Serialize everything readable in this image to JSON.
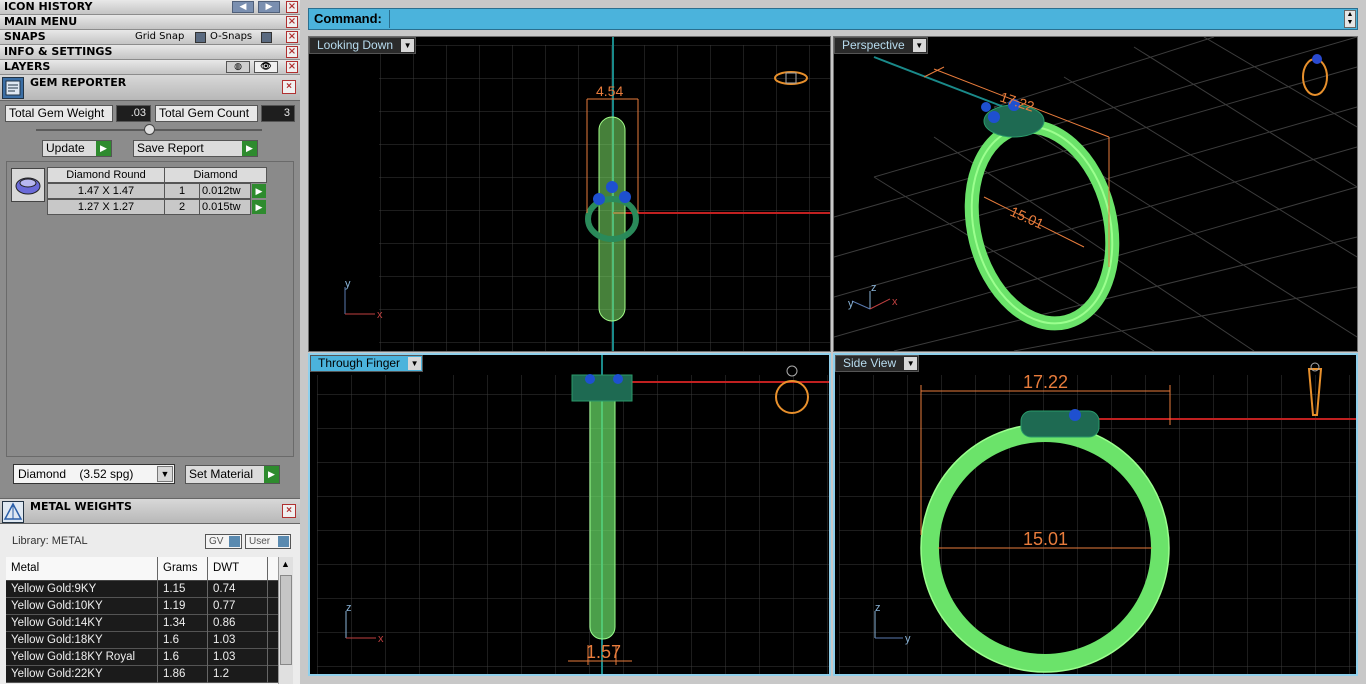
{
  "menu": {
    "icon_history": "ICON HISTORY",
    "main_menu": "MAIN MENU",
    "snaps": "SNAPS",
    "grid_snap": "Grid Snap",
    "o_snaps": "O-Snaps",
    "info_settings": "INFO & SETTINGS",
    "layers": "LAYERS"
  },
  "gem_reporter": {
    "title": "GEM REPORTER",
    "total_weight_label": "Total Gem Weight",
    "total_weight_value": ".03",
    "total_count_label": "Total Gem Count",
    "total_count_value": "3",
    "update_label": "Update",
    "save_report_label": "Save Report",
    "table": {
      "shape": "Diamond Round",
      "type": "Diamond",
      "rows": [
        {
          "size": "1.47 X 1.47",
          "count": "1",
          "weight": "0.012tw"
        },
        {
          "size": "1.27 X 1.27",
          "count": "2",
          "weight": "0.015tw"
        }
      ]
    },
    "material": "Diamond    (3.52 spg)",
    "set_material_label": "Set Material"
  },
  "metal_weights": {
    "title": "METAL WEIGHTS",
    "library": "Library: METAL",
    "gv_label": "GV",
    "user_label": "User",
    "headers": [
      "Metal",
      "Grams",
      "DWT"
    ],
    "rows": [
      [
        "Yellow Gold:9KY",
        "1.15",
        "0.74"
      ],
      [
        "Yellow Gold:10KY",
        "1.19",
        "0.77"
      ],
      [
        "Yellow Gold:14KY",
        "1.34",
        "0.86"
      ],
      [
        "Yellow Gold:18KY",
        "1.6",
        "1.03"
      ],
      [
        "Yellow Gold:18KY Royal",
        "1.6",
        "1.03"
      ],
      [
        "Yellow Gold:22KY",
        "1.86",
        "1.2"
      ]
    ]
  },
  "command": {
    "label": "Command:",
    "value": ""
  },
  "viewports": {
    "top_left": {
      "label": "Looking Down",
      "dimension": "4.54"
    },
    "top_right": {
      "label": "Perspective",
      "dim_a": "17.22",
      "dim_b": "15.01"
    },
    "bottom_left": {
      "label": "Through Finger",
      "dimension": "1.57"
    },
    "bottom_right": {
      "label": "Side View",
      "dim_a": "17.22",
      "dim_b": "15.01"
    }
  },
  "colors": {
    "accent": "#4bb3dc",
    "ring_green": "#5fe36a",
    "dimension_orange": "#e87c3c",
    "gem_blue": "#1e50d0"
  }
}
